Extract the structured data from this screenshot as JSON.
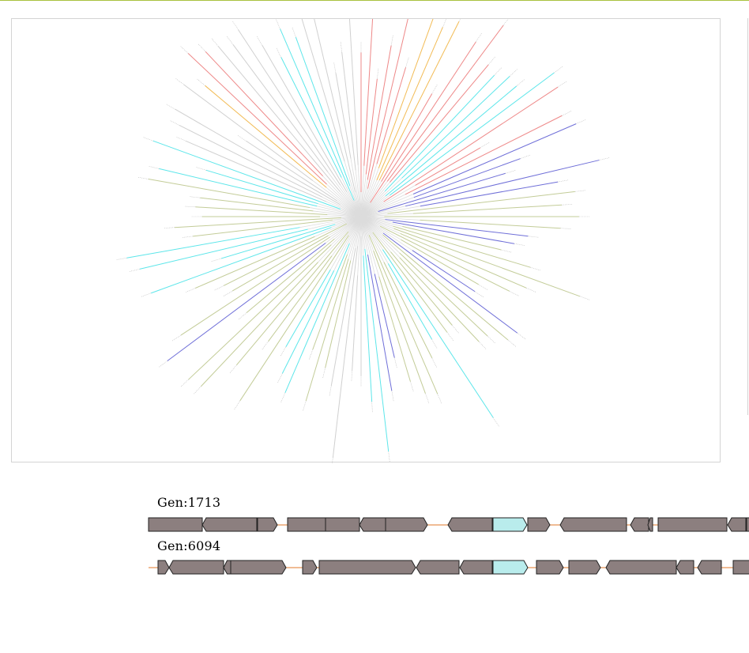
{
  "colors": {
    "accent_rule": "#a9c23f",
    "gene_fill": "#8c7f7f",
    "gene_highlight": "#b9ecec",
    "backbone": "#e07a2a",
    "panel_border": "#d4d4d4",
    "clade_colors": {
      "red": "#ee8888",
      "orange": "#f2bb55",
      "cyan": "#5de6ea",
      "blue": "#6f6fd8",
      "olive": "#c3cc98",
      "grey": "#d0d0d0"
    }
  },
  "tree": {
    "type": "radial phylogenetic tree"
  },
  "genomes": [
    {
      "label": "Gen:1713",
      "genes": [
        {
          "s": 188,
          "e": 256,
          "dir": "none"
        },
        {
          "s": 256,
          "e": 325,
          "dir": "left"
        },
        {
          "s": 326,
          "e": 351,
          "dir": "right"
        },
        {
          "s": 364,
          "e": 412,
          "dir": "none"
        },
        {
          "s": 412,
          "e": 455,
          "dir": "none"
        },
        {
          "s": 455,
          "e": 488,
          "dir": "left"
        },
        {
          "s": 488,
          "e": 541,
          "dir": "right"
        },
        {
          "s": 567,
          "e": 623,
          "dir": "left"
        },
        {
          "s": 624,
          "e": 667,
          "dir": "right",
          "highlight": true
        },
        {
          "s": 668,
          "e": 696,
          "dir": "right"
        },
        {
          "s": 709,
          "e": 793,
          "dir": "left"
        },
        {
          "s": 798,
          "e": 821,
          "dir": "left"
        },
        {
          "s": 820,
          "e": 826,
          "dir": "left"
        },
        {
          "s": 833,
          "e": 920,
          "dir": "none"
        },
        {
          "s": 921,
          "e": 944,
          "dir": "left"
        },
        {
          "s": 945,
          "e": 960,
          "dir": "none"
        }
      ]
    },
    {
      "label": "Gen:6094",
      "genes": [
        {
          "s": 200,
          "e": 214,
          "dir": "right"
        },
        {
          "s": 214,
          "e": 283,
          "dir": "left"
        },
        {
          "s": 283,
          "e": 292,
          "dir": "left"
        },
        {
          "s": 292,
          "e": 362,
          "dir": "right"
        },
        {
          "s": 383,
          "e": 401,
          "dir": "right"
        },
        {
          "s": 404,
          "e": 526,
          "dir": "right"
        },
        {
          "s": 527,
          "e": 581,
          "dir": "left"
        },
        {
          "s": 582,
          "e": 623,
          "dir": "left"
        },
        {
          "s": 624,
          "e": 668,
          "dir": "right",
          "highlight": true
        },
        {
          "s": 679,
          "e": 713,
          "dir": "right"
        },
        {
          "s": 720,
          "e": 760,
          "dir": "right"
        },
        {
          "s": 767,
          "e": 856,
          "dir": "left"
        },
        {
          "s": 856,
          "e": 878,
          "dir": "left"
        },
        {
          "s": 883,
          "e": 913,
          "dir": "left"
        },
        {
          "s": 928,
          "e": 960,
          "dir": "none"
        }
      ]
    }
  ]
}
